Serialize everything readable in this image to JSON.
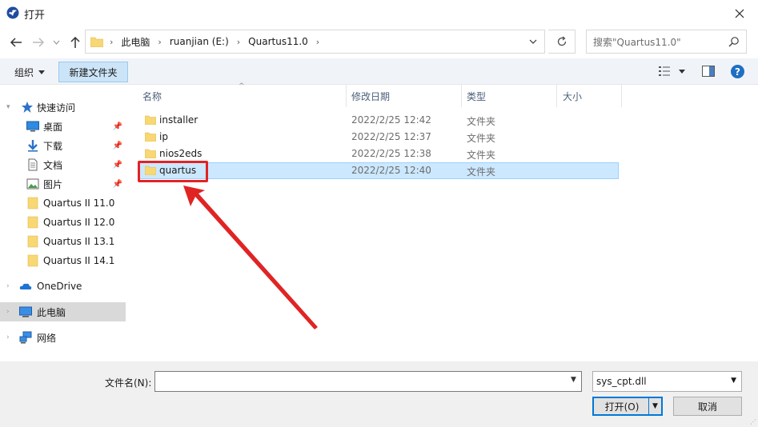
{
  "window": {
    "title": "打开"
  },
  "address": {
    "crumbs": [
      "此电脑",
      "ruanjian (E:)",
      "Quartus11.0"
    ]
  },
  "search": {
    "placeholder": "搜索\"Quartus11.0\""
  },
  "toolbar": {
    "organize_label": "组织",
    "new_folder_label": "新建文件夹",
    "help_label": "?"
  },
  "sidebar": {
    "items": [
      {
        "label": "快速访问",
        "icon": "star-icon"
      },
      {
        "label": "桌面",
        "icon": "desktop-icon",
        "pinned": true
      },
      {
        "label": "下载",
        "icon": "download-icon",
        "pinned": true
      },
      {
        "label": "文档",
        "icon": "document-icon",
        "pinned": true
      },
      {
        "label": "图片",
        "icon": "picture-icon",
        "pinned": true
      },
      {
        "label": "Quartus II 11.0",
        "icon": "folder-icon"
      },
      {
        "label": "Quartus II 12.0",
        "icon": "folder-icon"
      },
      {
        "label": "Quartus II 13.1",
        "icon": "folder-icon"
      },
      {
        "label": "Quartus II 14.1",
        "icon": "folder-icon"
      },
      {
        "label": "OneDrive",
        "icon": "cloud-icon"
      },
      {
        "label": "此电脑",
        "icon": "computer-icon",
        "selected": true
      },
      {
        "label": "网络",
        "icon": "network-icon"
      }
    ]
  },
  "filelist": {
    "columns": [
      "名称",
      "修改日期",
      "类型",
      "大小"
    ],
    "rows": [
      {
        "name": "installer",
        "date": "2022/2/25 12:42",
        "type": "文件夹"
      },
      {
        "name": "ip",
        "date": "2022/2/25 12:37",
        "type": "文件夹"
      },
      {
        "name": "nios2eds",
        "date": "2022/2/25 12:38",
        "type": "文件夹"
      },
      {
        "name": "quartus",
        "date": "2022/2/25 12:40",
        "type": "文件夹",
        "selected": true
      }
    ]
  },
  "bottom": {
    "filename_label": "文件名(N):",
    "filename_value": "",
    "filter_value": "sys_cpt.dll",
    "open_label": "打开(O)",
    "cancel_label": "取消"
  },
  "colors": {
    "annotation": "#e02424",
    "selection": "#cce8ff",
    "accent": "#0078d7"
  }
}
